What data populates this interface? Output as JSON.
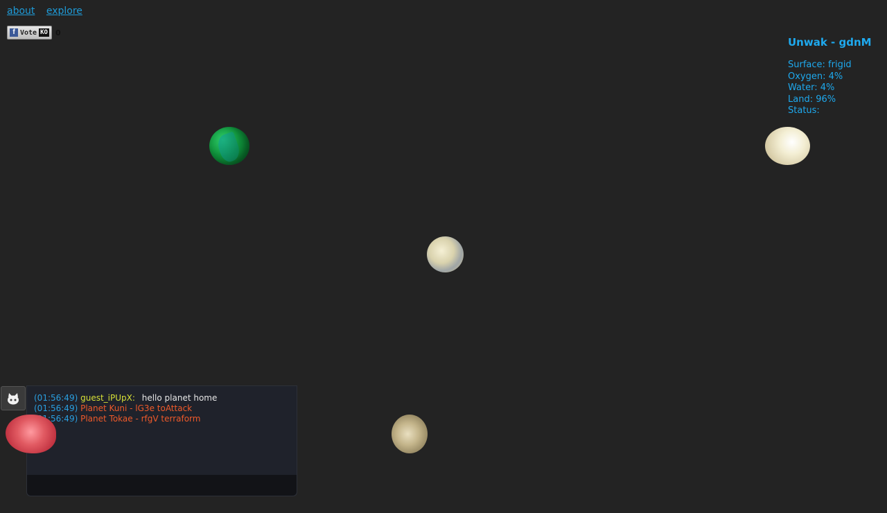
{
  "nav": {
    "about": "about",
    "explore": "explore"
  },
  "vote": {
    "label": "Vote",
    "badge": "KO",
    "count": "0"
  },
  "planet_info": {
    "title": "Unwak - gdnM",
    "surface": "Surface: frigid",
    "oxygen": "Oxygen: 4%",
    "water": "Water: 4%",
    "land": "Land: 96%",
    "status": "Status:"
  },
  "chat": {
    "messages": [
      {
        "time": "(01:56:49)",
        "user": "guest_iPUpX:",
        "text": "hello planet home"
      },
      {
        "time": "(01:56:49)",
        "text": "Planet Kuni - lG3e toAttack"
      },
      {
        "time": "(01:56:49)",
        "text": "Planet Tokae - rfgV terraform"
      }
    ]
  },
  "colors": {
    "accent": "#1ea9ee",
    "system_msg": "#ef5a2a",
    "username": "#d7e037",
    "background": "#232323"
  },
  "icons": {
    "github": "github-octocat-icon",
    "facebook": "facebook-icon"
  }
}
